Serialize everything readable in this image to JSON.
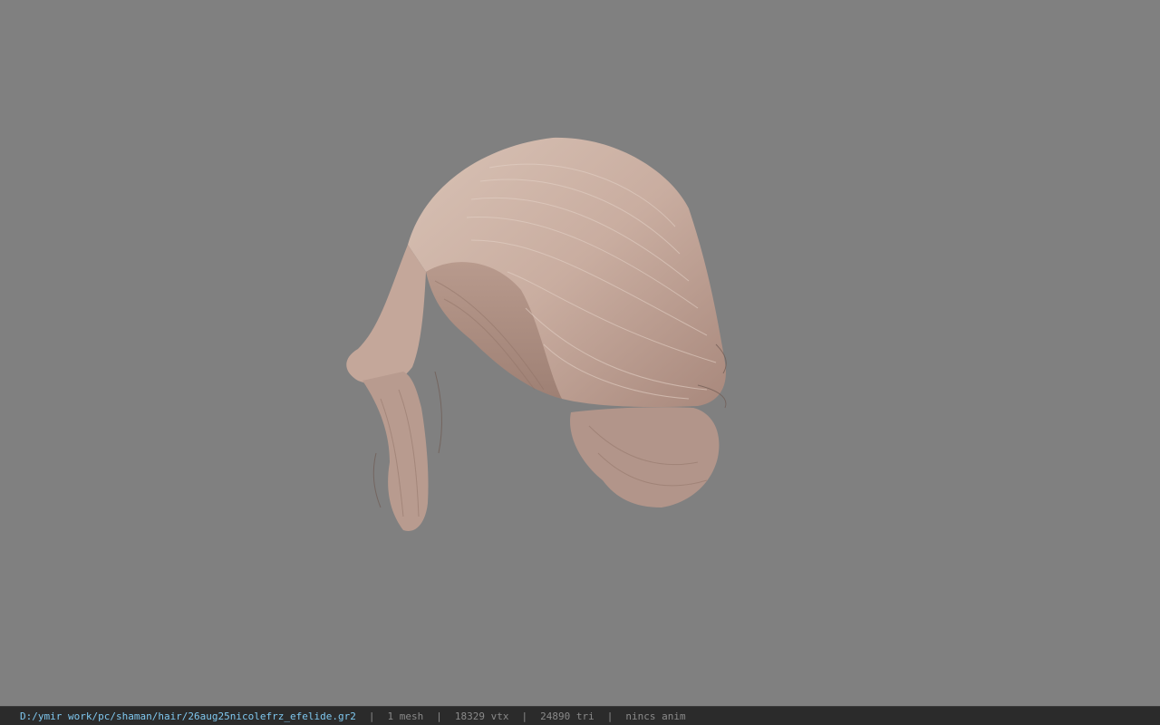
{
  "viewport": {
    "background_color": "#808080",
    "model_description": "hair-mesh",
    "hair_color": "#c9ada0"
  },
  "status_bar": {
    "file_path": "D:/ymir work/pc/shaman/hair/26aug25nicolefrz_efelide.gr2",
    "separator": "|",
    "mesh_count": "1 mesh",
    "vertex_count": "18329 vtx",
    "triangle_count": "24890 tri",
    "anim_status": "nincs anim",
    "path_color": "#7fc8f0",
    "text_color": "#8a8a8a",
    "background_color": "#2b2b2b"
  }
}
